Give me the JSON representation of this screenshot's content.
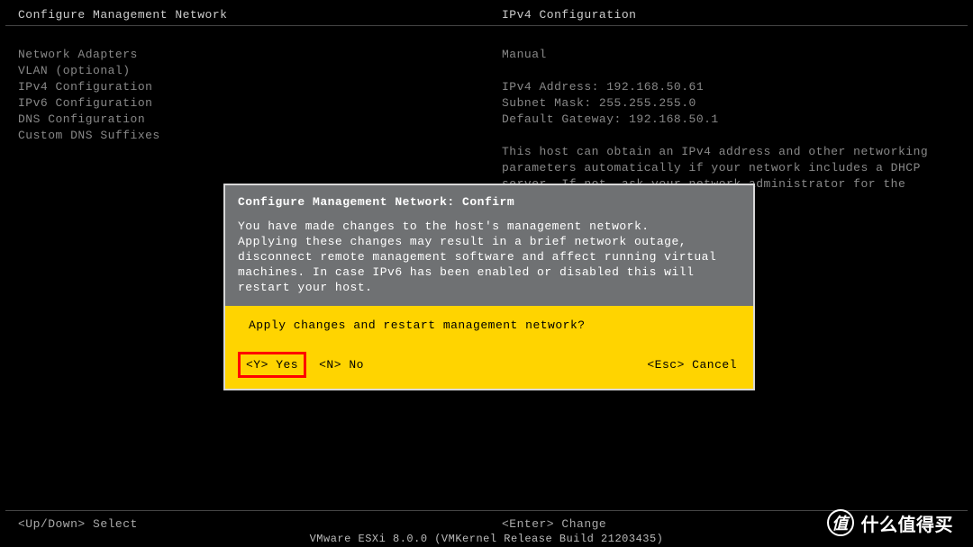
{
  "header": {
    "left": "Configure Management Network",
    "right": "IPv4 Configuration"
  },
  "menu": {
    "items": [
      "Network Adapters",
      "VLAN (optional)",
      "",
      "IPv4 Configuration",
      "IPv6 Configuration",
      "DNS Configuration",
      "Custom DNS Suffixes"
    ]
  },
  "info": {
    "mode": "Manual",
    "ipv4_label": "IPv4 Address: 192.168.50.61",
    "mask_label": "Subnet Mask: 255.255.255.0",
    "gw_label": "Default Gateway: 192.168.50.1",
    "help": "This host can obtain an IPv4 address and other networking parameters automatically if your network includes a DHCP server. If not, ask your network administrator for the appropriate settings."
  },
  "dialog": {
    "title": "Configure Management Network: Confirm",
    "body": "You have made changes to the host's management network.\nApplying these changes may result in a brief network outage,\ndisconnect remote management software and affect running virtual\nmachines. In case IPv6 has been enabled or disabled this will\nrestart your host.",
    "question": "Apply changes and restart management network?",
    "yes": "<Y> Yes",
    "no": "<N> No",
    "cancel": "<Esc> Cancel"
  },
  "footer": {
    "left": "<Up/Down> Select",
    "right": "<Enter> Change",
    "version": "VMware ESXi 8.0.0 (VMKernel Release Build 21203435)"
  },
  "watermark": {
    "icon": "值",
    "text": "什么值得买"
  }
}
